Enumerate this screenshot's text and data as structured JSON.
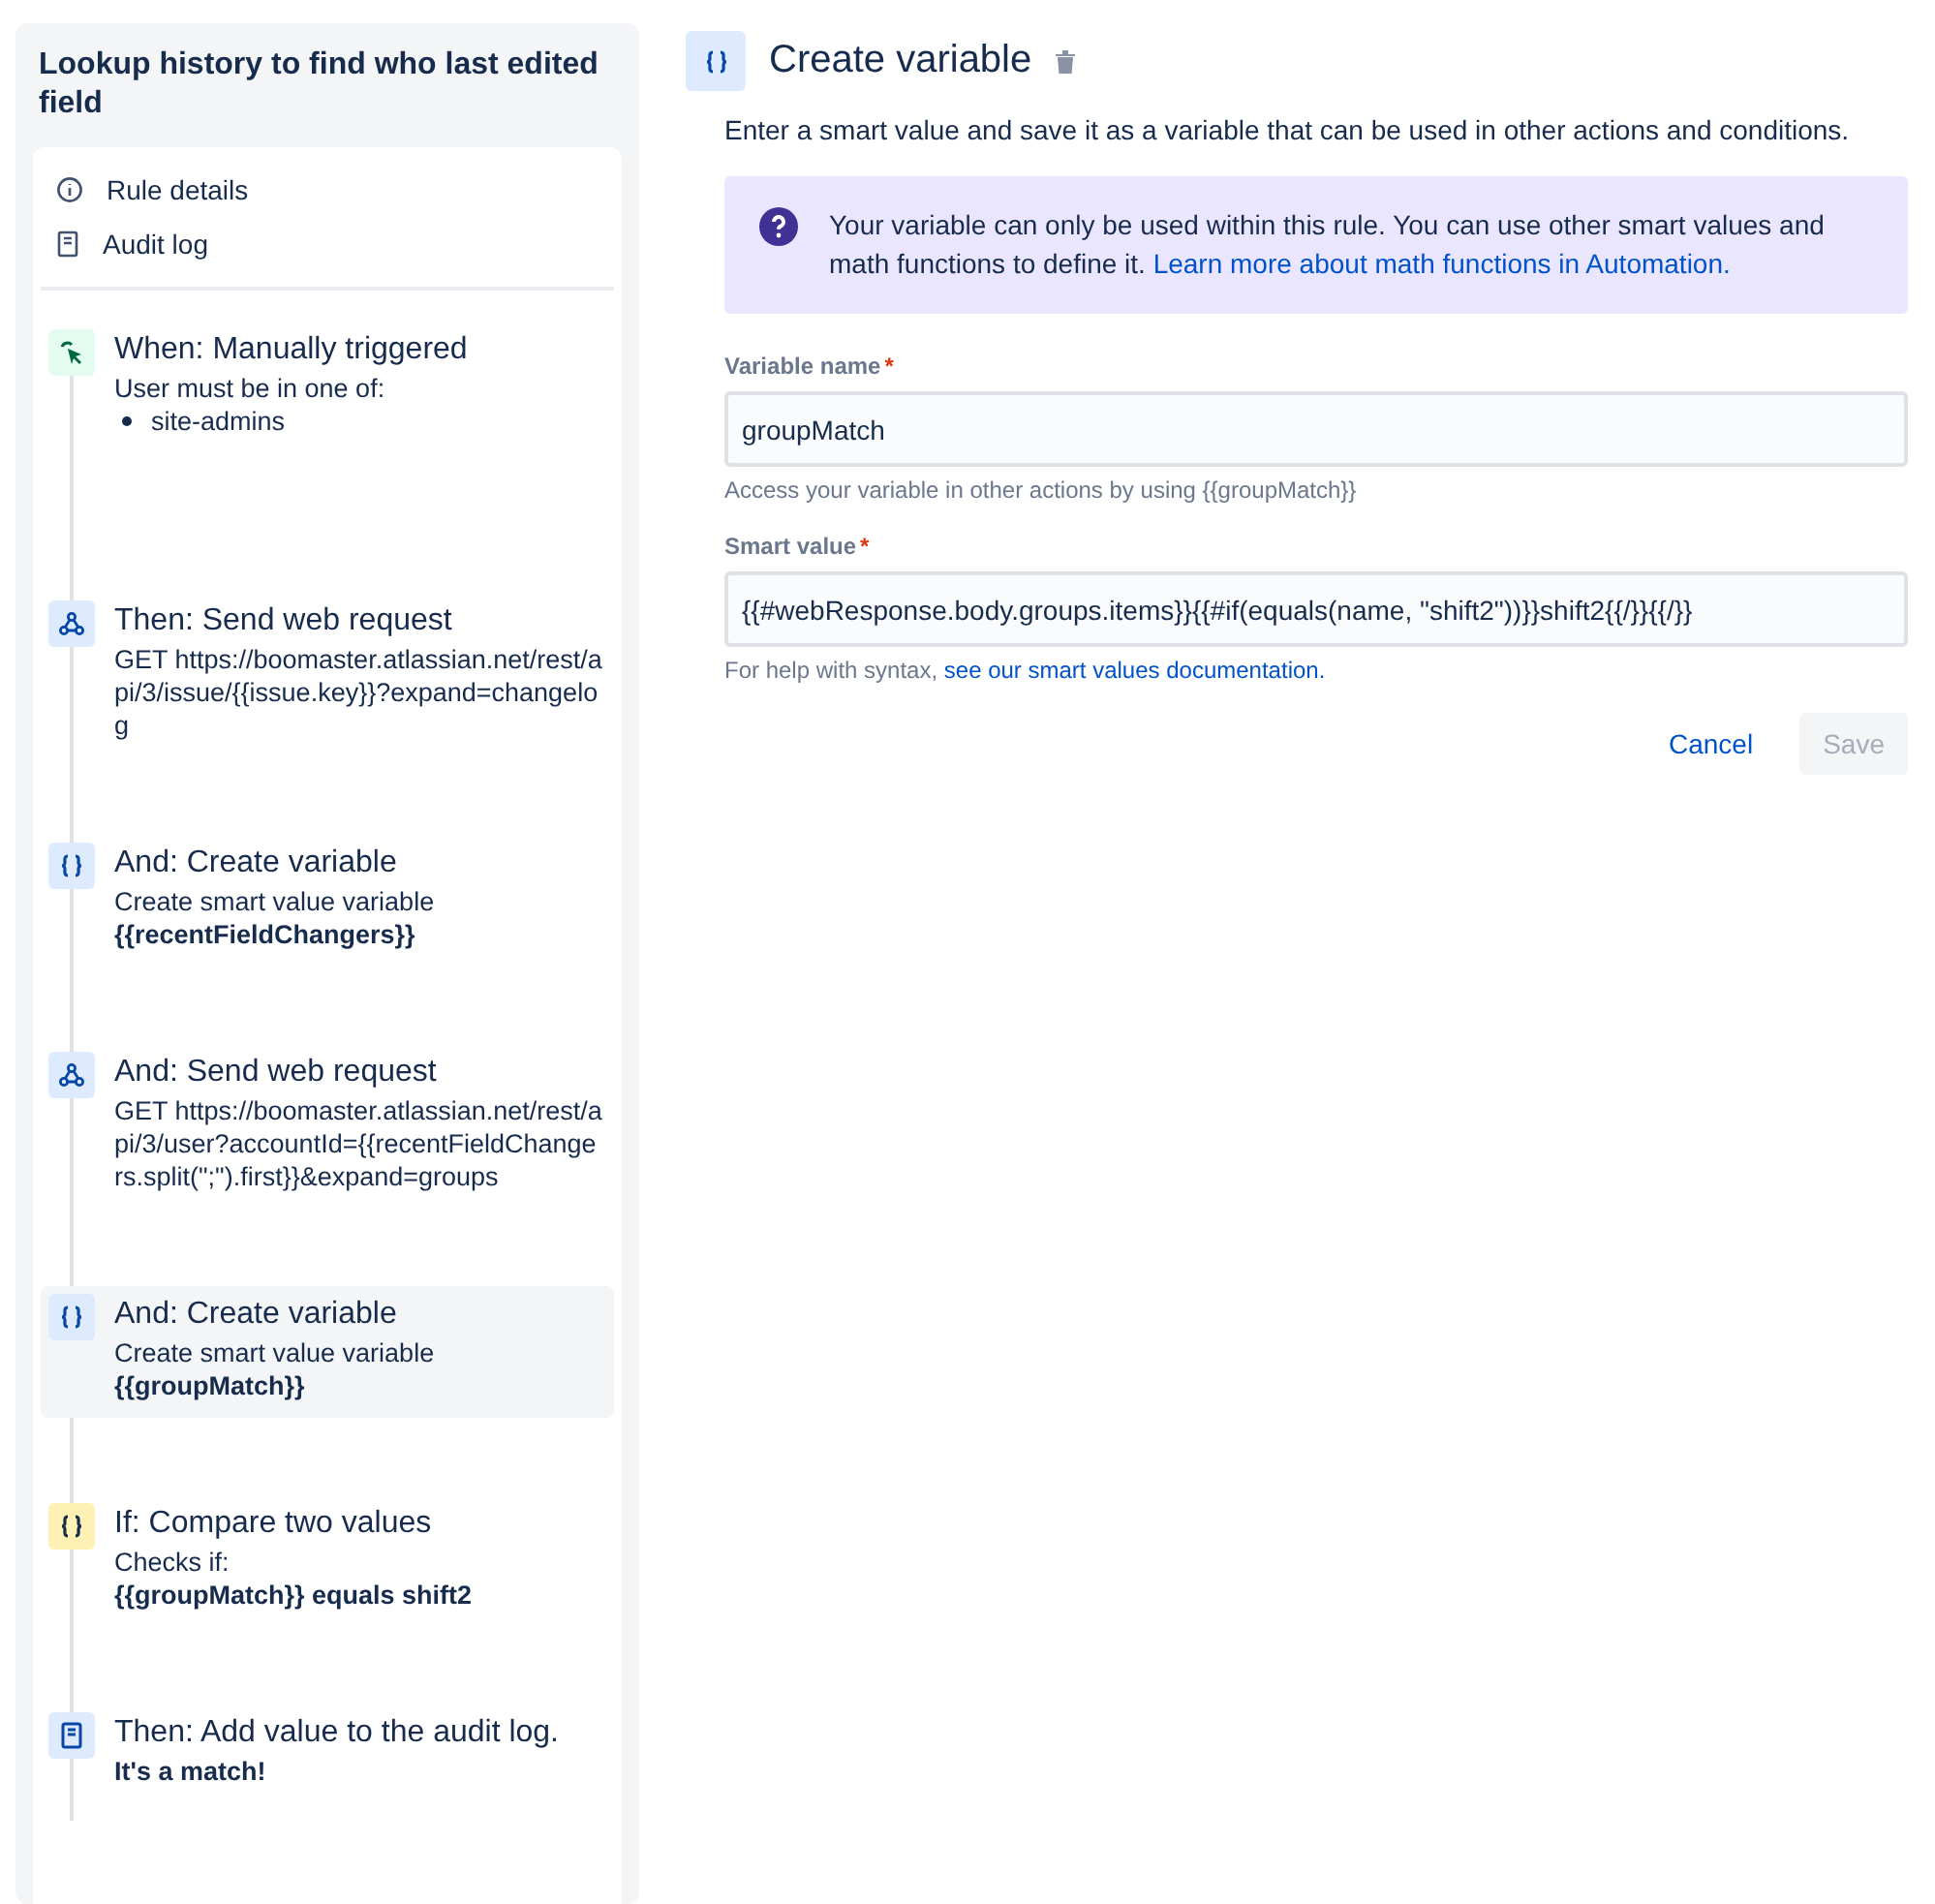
{
  "rule": {
    "title": "Lookup history to find who last edited field"
  },
  "menu": [
    {
      "label": "Rule details",
      "kind": "info"
    },
    {
      "label": "Audit log",
      "kind": "log"
    }
  ],
  "steps": [
    {
      "kind": "trigger",
      "title": "When: Manually triggered",
      "selected": false,
      "details": [
        {
          "kind": "text",
          "text": "User must be in one of:"
        },
        {
          "kind": "bullet",
          "text": "site-admins"
        }
      ]
    },
    {
      "kind": "webrequest",
      "title": "Then: Send web request",
      "selected": false,
      "details": [
        {
          "kind": "text",
          "text": "GET https://boomaster.atlassian.net/rest/api/3/issue/{{issue.key}}?expand=changelog"
        }
      ]
    },
    {
      "kind": "variable",
      "title": "And: Create variable",
      "selected": false,
      "details": [
        {
          "kind": "text",
          "text": "Create smart value variable"
        },
        {
          "kind": "bold",
          "text": "{{recentFieldChangers}}"
        }
      ]
    },
    {
      "kind": "webrequest",
      "title": "And: Send web request",
      "selected": false,
      "details": [
        {
          "kind": "text",
          "text": "GET https://boomaster.atlassian.net/rest/api/3/user?accountId={{recentFieldChangers.split(\";\").first}}&expand=groups"
        }
      ]
    },
    {
      "kind": "variable",
      "title": "And: Create variable",
      "selected": true,
      "details": [
        {
          "kind": "text",
          "text": "Create smart value variable"
        },
        {
          "kind": "bold",
          "text": "{{groupMatch}}"
        }
      ]
    },
    {
      "kind": "condition",
      "title": "If: Compare two values",
      "selected": false,
      "details": [
        {
          "kind": "text",
          "text": "Checks if:"
        },
        {
          "kind": "bold",
          "text": "{{groupMatch}} equals shift2"
        }
      ]
    },
    {
      "kind": "log",
      "title": "Then: Add value to the audit log.",
      "selected": false,
      "details": [
        {
          "kind": "bold",
          "text": "It's a match!"
        }
      ]
    }
  ],
  "editor": {
    "title": "Create variable",
    "description": "Enter a smart value and save it as a variable that can be used in other actions and conditions.",
    "info": {
      "text": "Your variable can only be used within this rule. You can use other smart values and math functions to define it.",
      "link": "Learn more about math functions in Automation."
    },
    "fields": [
      {
        "label": "Variable name",
        "required_mark": "*",
        "value": "groupMatch",
        "help": "Access your variable in other actions by using {{groupMatch}}"
      },
      {
        "label": "Smart value",
        "required_mark": "*",
        "value": "{{#webResponse.body.groups.items}}{{#if(equals(name, \"shift2\"))}}shift2{{/}}{{/}}",
        "help": "For help with syntax,",
        "help_link": "see our smart values documentation."
      }
    ],
    "buttons": [
      {
        "label": "Cancel",
        "kind": "link",
        "disabled": false
      },
      {
        "label": "Save",
        "kind": "primary",
        "disabled": true
      }
    ]
  }
}
